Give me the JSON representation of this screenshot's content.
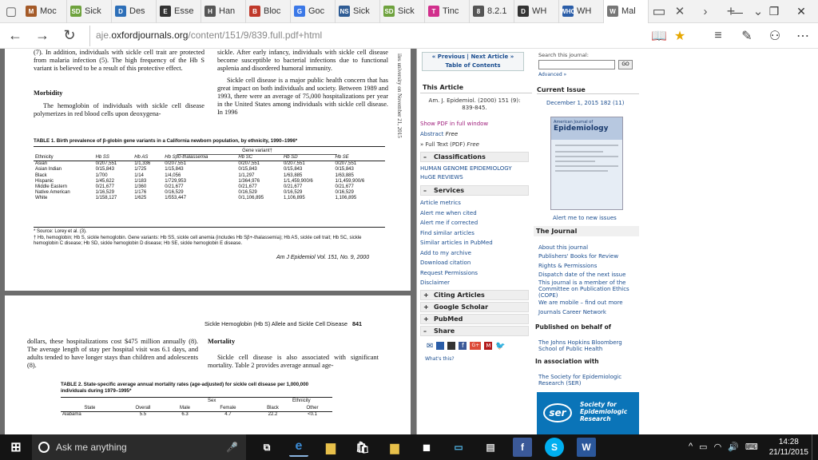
{
  "tabs": [
    {
      "label": "Moc",
      "fav": "M",
      "color": "#a45a28"
    },
    {
      "label": "Sick",
      "fav": "SD",
      "color": "#6ea23d"
    },
    {
      "label": "Des",
      "fav": "D",
      "color": "#2d6fb8"
    },
    {
      "label": "Esse",
      "fav": "E",
      "color": "#333333"
    },
    {
      "label": "Han",
      "fav": "H",
      "color": "#555555"
    },
    {
      "label": "Bloc",
      "fav": "B",
      "color": "#c0392b"
    },
    {
      "label": "Goc",
      "fav": "G",
      "color": "#3b78e7"
    },
    {
      "label": "Sick",
      "fav": "NS",
      "color": "#2f5c94"
    },
    {
      "label": "Sick",
      "fav": "SD",
      "color": "#6ea23d"
    },
    {
      "label": "Tinc",
      "fav": "T",
      "color": "#d12f8c"
    },
    {
      "label": "8.2.1",
      "fav": "8",
      "color": "#555555"
    },
    {
      "label": "WH",
      "fav": "D",
      "color": "#333333"
    },
    {
      "label": "WH",
      "fav": "WHO",
      "color": "#2a5da8"
    },
    {
      "label": "Mal",
      "fav": "W",
      "color": "#777777"
    }
  ],
  "address": {
    "prefix": "aje.",
    "domain": "oxfordjournals.org",
    "path": "/content/151/9/839.full.pdf+html"
  },
  "pdf": {
    "p1_col1": "(7). In addition, individuals with sickle cell trait are protected from malaria infection (5). The high frequency of the Hb S variant is believed to be a result of this protective effect.",
    "p1_head1": "Morbidity",
    "p1_col1b": "The hemoglobin of individuals with sickle cell disease polymerizes in red blood cells upon deoxygena-",
    "p1_col2": "sickle. After early infancy, individuals with sickle cell disease become susceptible to bacterial infections due to functional asplenia and disordered humoral immunity.",
    "p1_col2b": "Sickle cell disease is a major public health concern that has great impact on both individuals and society. Between 1989 and 1993, there were an average of 75,000 hospitalizations per year in the United States among individuals with sickle cell disease. In 1996",
    "side_note": "iles university on November 21, 2015",
    "table1_caption": "TABLE 1.   Birth prevalence of β-globin gene variants in a California newborn population, by ethnicity, 1990–1996*",
    "table1_group": "Gene variant†",
    "table1_headers": [
      "Ethnicity",
      "Hb SS",
      "Hb AS",
      "Hb Sβ0-thalassemia",
      "Hb SC",
      "Hb SD",
      "Hb SE"
    ],
    "table1_rows": [
      [
        "Asian",
        "0/207,551",
        "1/1,336",
        "0/207,551",
        "0/207,551",
        "0/207,551",
        "0/207,551"
      ],
      [
        "Asian Indian",
        "0/15,843",
        "1/725",
        "1/15,843",
        "0/15,843",
        "0/15,843",
        "0/15,843"
      ],
      [
        "Black",
        "1/700",
        "1/14",
        "1/4,056",
        "1/1,297",
        "1/63,885",
        "1/63,885"
      ],
      [
        "Hispanic",
        "1/45,622",
        "1/183",
        "1/729,953",
        "1/364,976",
        "1/1,459,900/6",
        "1/1,459,900/6"
      ],
      [
        "Middle Eastern",
        "0/21,677",
        "1/360",
        "0/21,677",
        "0/21,677",
        "0/21,677",
        "0/21,677"
      ],
      [
        "Native American",
        "1/16,529",
        "1/176",
        "0/16,529",
        "0/16,529",
        "0/16,529",
        "0/16,529"
      ],
      [
        "White",
        "1/158,127",
        "1/625",
        "1/553,447",
        "0/1,106,895",
        "1,106,895",
        "1,106,895"
      ]
    ],
    "table1_fn1": "* Source: Lorey et al. (3).",
    "table1_fn2": "† Hb, hemoglobin; Hb S, sickle hemoglobin. Gene variants: Hb SS, sickle cell anemia (includes Hb Sβ+-thalassemia); Hb AS, sickle cell trait; Hb SC, sickle hemoglobin C disease; Hb SD, sickle hemoglobin D disease; Hb SE, sickle hemoglobin E disease.",
    "journal_ref": "Am J Epidemiol   Vol. 151, No. 9, 2000",
    "p2_runhead": "Sickle Hemoglobin (Hb S) Allele and Sickle Cell Disease",
    "p2_pagenum": "841",
    "p2_col1": "dollars, these hospitalizations cost $475 million annually (8). The average length of stay per hospital visit was 6.1 days, and adults tended to have longer stays than children and adolescents (8).",
    "p2_head2": "Mortality",
    "p2_col2": "Sickle cell disease is also associated with significant mortality. Table 2 provides average annual age-",
    "table2_caption": "TABLE 2.   State-specific average annual mortality rates (age-adjusted) for sickle cell disease per 1,000,000 individuals during 1979–1995*",
    "table2_h": [
      "State",
      "Overall",
      "Male",
      "Female",
      "Black",
      "Other"
    ],
    "table2_g1": "Sex",
    "table2_g2": "Ethnicity",
    "table2_rows": [
      [
        "Alabama",
        "5.5",
        "6.3",
        "4.7",
        "22.2",
        "<0.1"
      ]
    ]
  },
  "site": {
    "prev": "« Previous",
    "next": "Next Article »",
    "toc": "Table of Contents",
    "this_article": "This Article",
    "citation": "Am. J. Epidemiol. (2000) 151 (9): 839-845.",
    "show_pdf": "Show PDF in full window",
    "abstract": "Abstract",
    "abstract_free": "Free",
    "fulltext": "» Full Text (PDF)",
    "fulltext_free": "Free",
    "classifications": "Classifications",
    "class_links": [
      "HUMAN GENOME EPIDEMIOLOGY",
      "HuGE REVIEWS"
    ],
    "services": "Services",
    "service_links": [
      "Article metrics",
      "Alert me when cited",
      "Alert me if corrected",
      "Find similar articles",
      "Similar articles in PubMed",
      "Add to my archive",
      "Download citation",
      "Request Permissions",
      "Disclaimer"
    ],
    "citing": "Citing Articles",
    "scholar": "Google Scholar",
    "pubmed": "PubMed",
    "share": "Share",
    "whats_this": "What's this?",
    "search_label": "Search this journal:",
    "advanced": "Advanced »",
    "go": "GO",
    "current_issue": "Current Issue",
    "issue_date": "December 1, 2015 182 (11)",
    "cover_title": "American Journal of",
    "cover_title2": "Epidemiology",
    "alert_issues": "Alert me to new issues",
    "the_journal": "The Journal",
    "journal_links": [
      "About this journal",
      "Publishers' Books for Review",
      "Rights & Permissions",
      "Dispatch date of the next issue",
      "This journal is a member of the Committee on Publication Ethics (COPE)",
      "We are mobile – find out more",
      "Journals Career Network"
    ],
    "published_by": "Published on behalf of",
    "publisher": "The Johns Hopkins Bloomberg School of Public Health",
    "association": "In association with",
    "society": "The Society for Epidemiologic Research (SER)",
    "ser_logo": "ser",
    "ser_text": "Society for Epidemiologic Research"
  },
  "taskbar": {
    "search": "Ask me anything",
    "time": "14:28",
    "date": "21/11/2015"
  }
}
